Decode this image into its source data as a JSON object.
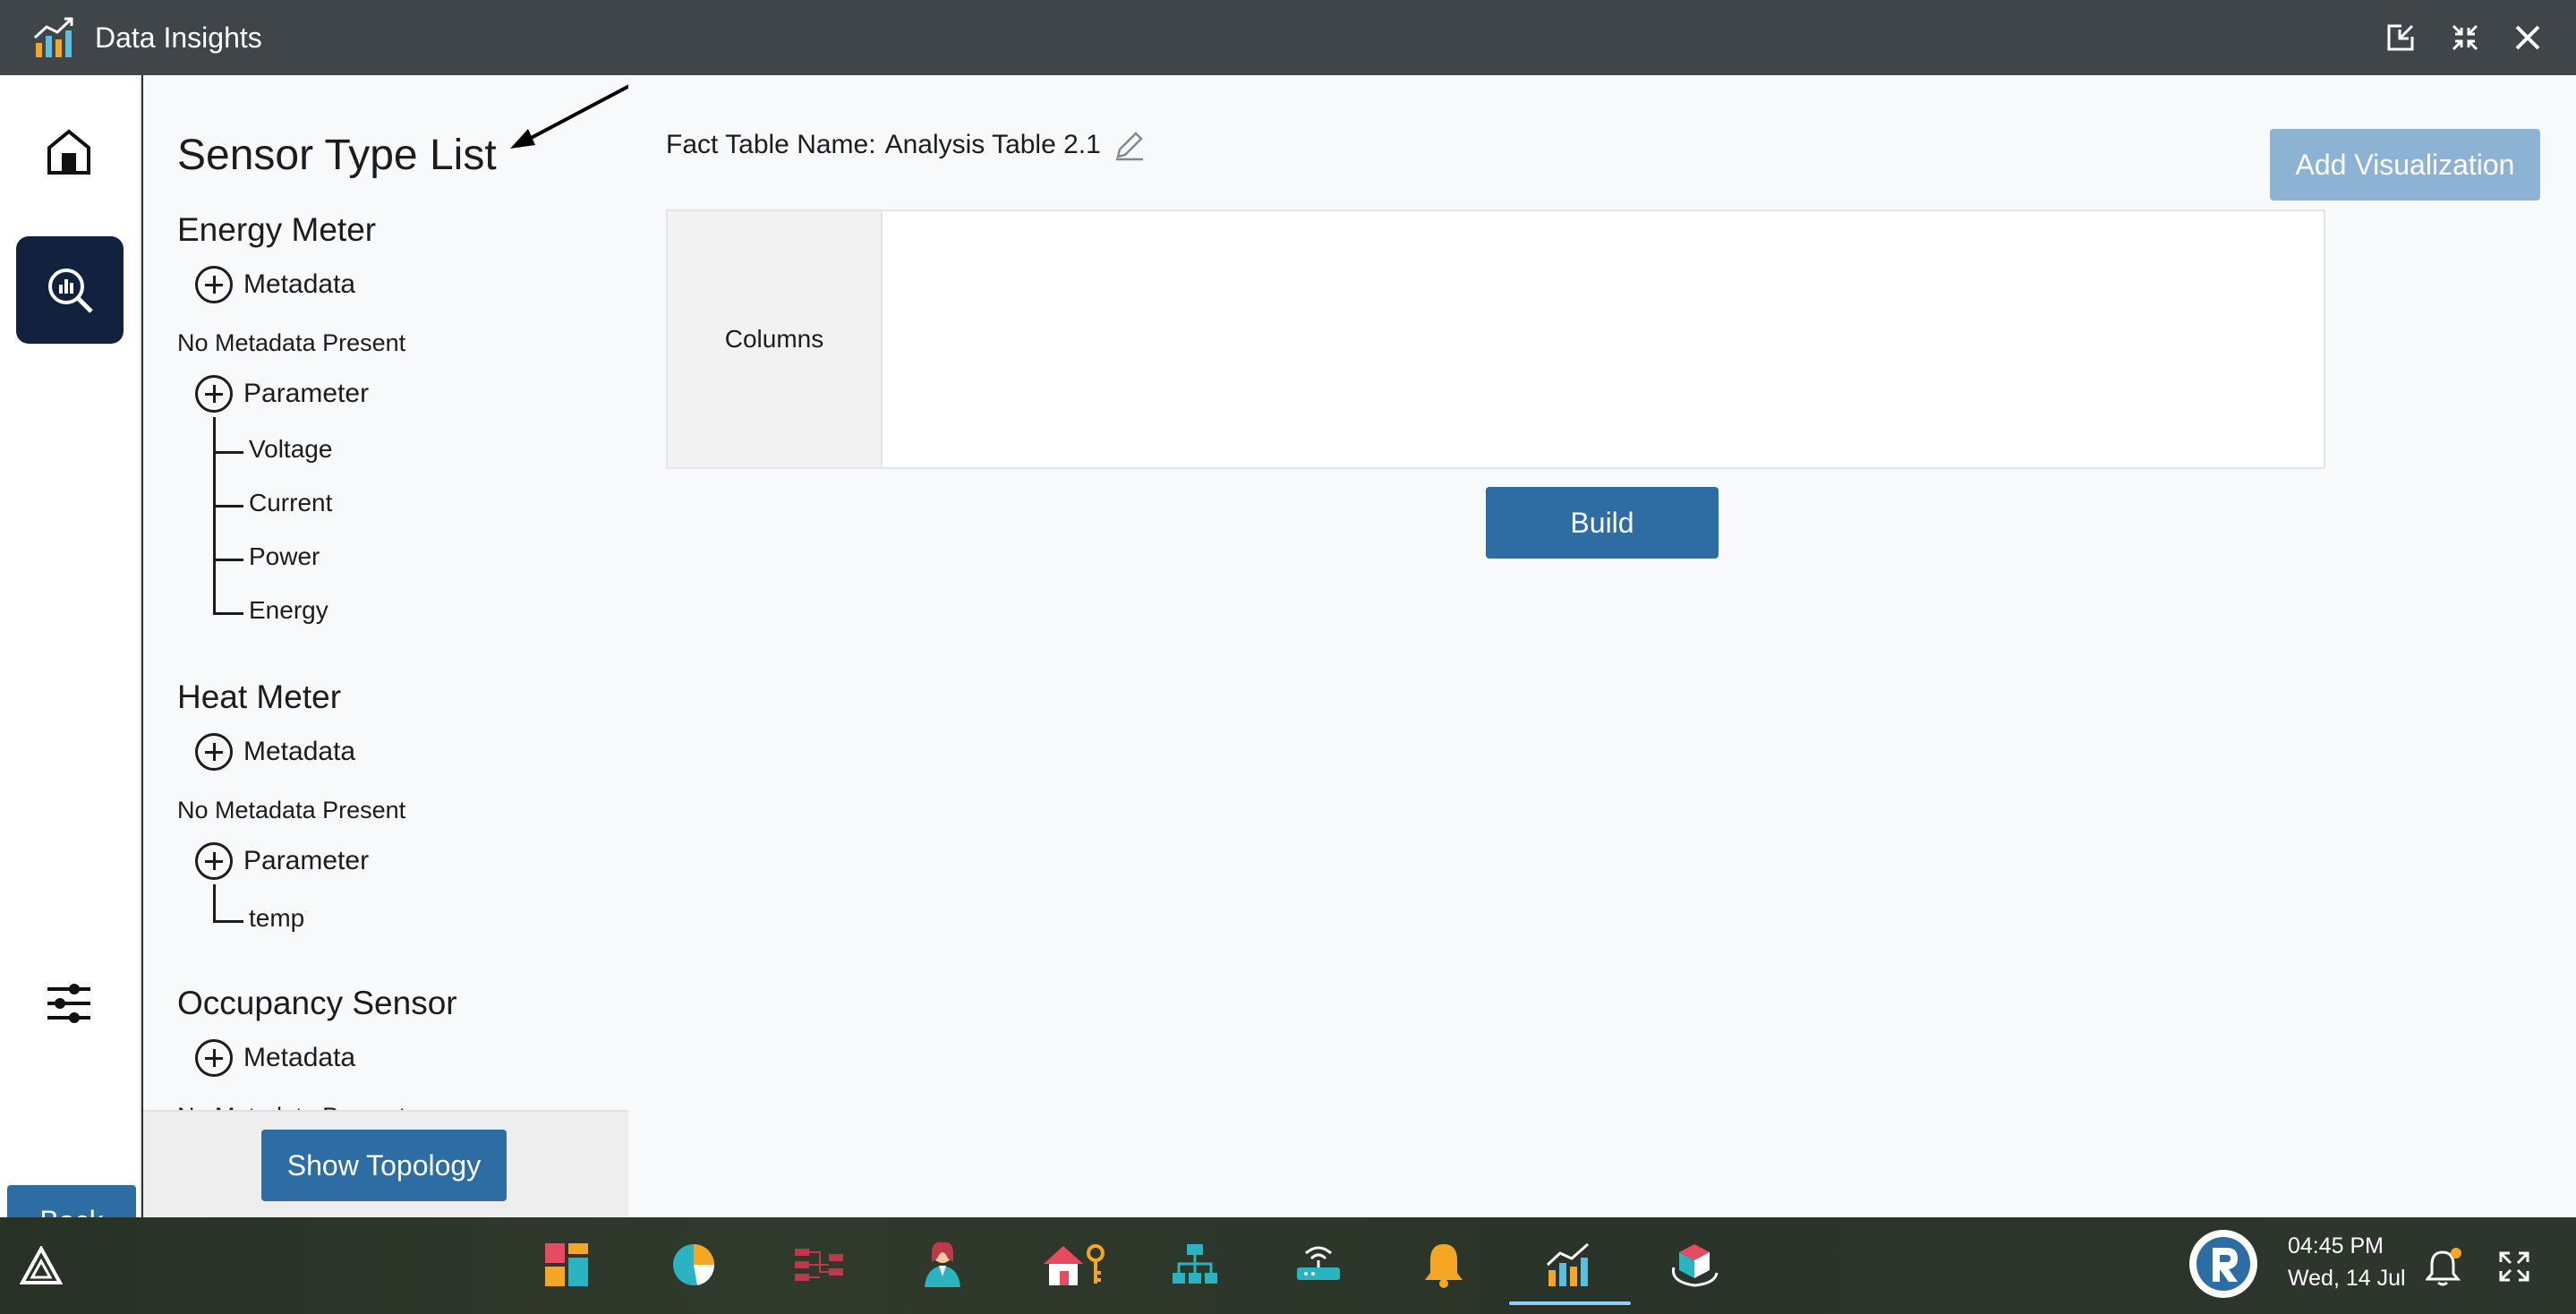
{
  "window": {
    "title": "Data Insights"
  },
  "nav": {
    "back_label": "Back"
  },
  "sensor_panel": {
    "title": "Sensor Type List",
    "groups": [
      {
        "name": "Energy Meter",
        "metadata_label": "Metadata",
        "metadata_status": "No Metadata Present",
        "parameter_label": "Parameter",
        "parameters": [
          "Voltage",
          "Current",
          "Power",
          "Energy"
        ]
      },
      {
        "name": "Heat Meter",
        "metadata_label": "Metadata",
        "metadata_status": "No Metadata Present",
        "parameter_label": "Parameter",
        "parameters": [
          "temp"
        ]
      },
      {
        "name": "Occupancy Sensor",
        "metadata_label": "Metadata",
        "metadata_status": "No Metadata Present"
      }
    ],
    "show_topology_label": "Show Topology"
  },
  "main": {
    "fact_table_label": "Fact Table Name:",
    "fact_table_name": "Analysis Table 2.1",
    "add_visualization_label": "Add Visualization",
    "columns_label": "Columns",
    "build_label": "Build"
  },
  "taskbar": {
    "apps": [
      "dashboard-app",
      "analytics-pie-app",
      "flow-app",
      "user-app",
      "home-access-app",
      "topology-app",
      "gateway-app",
      "alerts-app",
      "data-insights-app",
      "cube-app"
    ],
    "active_app": "data-insights-app",
    "time": "04:45 PM",
    "date": "Wed, 14 Jul"
  },
  "colors": {
    "titlebar": "#3f4549",
    "primary_button": "#2e6da4",
    "disabled_button": "#8cb3d4",
    "nav_active": "#12213d"
  }
}
